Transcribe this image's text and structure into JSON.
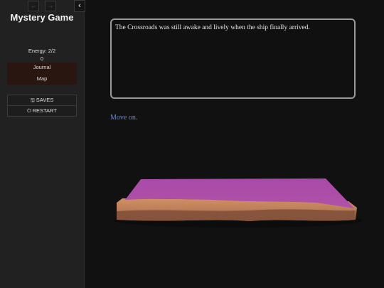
{
  "sidebar": {
    "history_back_icon": "arrow-left-icon",
    "history_forward_icon": "arrow-right-icon",
    "toggle_icon": "chevron-left-icon",
    "story_title": "Mystery Game",
    "energy": "Energy: 2/2",
    "counter": "0",
    "nav": {
      "journal": "Journal",
      "map": "Map"
    },
    "menu": {
      "saves_label": "SAVES",
      "saves_icon": "save-icon",
      "restart_label": "RESTART",
      "restart_icon": "power-icon"
    }
  },
  "passage": {
    "text": "The Crossroads was still awake and lively when the ship finally arrived.",
    "link": "Move on."
  },
  "colors": {
    "background": "#111111",
    "sidebar": "#212121",
    "nav_box": "#2a1611",
    "link": "#6f86c8",
    "platform_top": "#a64aa6",
    "platform_side": "#c98a5e"
  }
}
